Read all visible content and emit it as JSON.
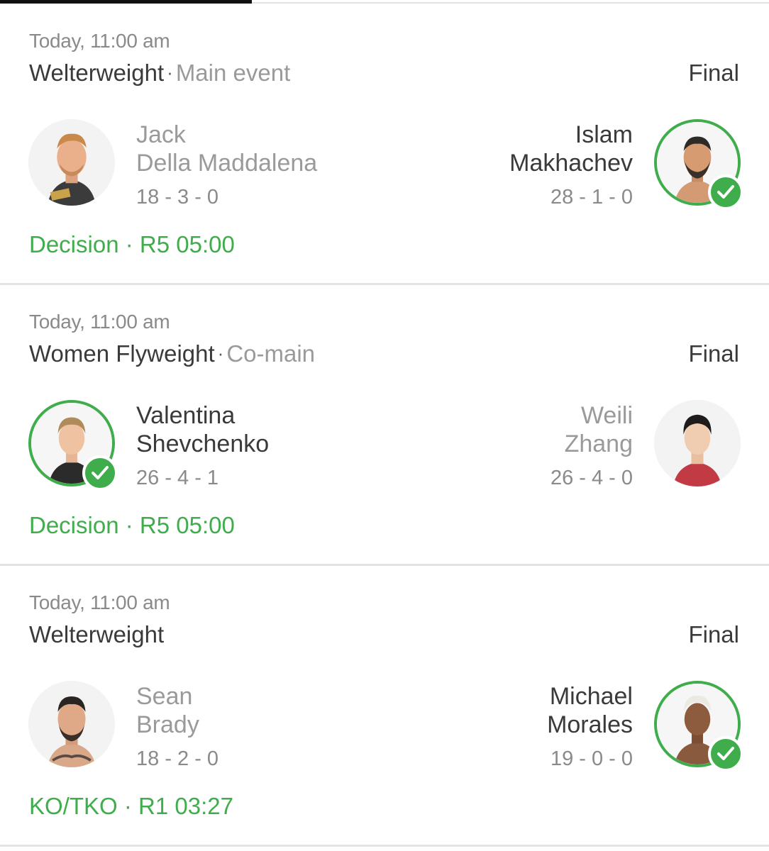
{
  "fights": [
    {
      "time": "Today, 11:00 am",
      "weight_class": "Welterweight",
      "billing": "Main event",
      "status": "Final",
      "left": {
        "first": "Jack",
        "last": "Della Maddalena",
        "record": "18 - 3 - 0",
        "winner": false,
        "photo": "fighter-photo"
      },
      "right": {
        "first": "Islam",
        "last": "Makhachev",
        "record": "28 - 1 - 0",
        "winner": true,
        "photo": "fighter-photo"
      },
      "result": "Decision · R5 05:00"
    },
    {
      "time": "Today, 11:00 am",
      "weight_class": "Women Flyweight",
      "billing": "Co-main",
      "status": "Final",
      "left": {
        "first": "Valentina",
        "last": "Shevchenko",
        "record": "26 - 4 - 1",
        "winner": true,
        "photo": "fighter-photo"
      },
      "right": {
        "first": "Weili",
        "last": "Zhang",
        "record": "26 - 4 - 0",
        "winner": false,
        "photo": "fighter-photo"
      },
      "result": "Decision · R5 05:00"
    },
    {
      "time": "Today, 11:00 am",
      "weight_class": "Welterweight",
      "billing": "",
      "status": "Final",
      "left": {
        "first": "Sean",
        "last": "Brady",
        "record": "18 - 2 - 0",
        "winner": false,
        "photo": "fighter-photo"
      },
      "right": {
        "first": "Michael",
        "last": "Morales",
        "record": "19 - 0 - 0",
        "winner": true,
        "photo": "fighter-photo"
      },
      "result": "KO/TKO · R1 03:27"
    }
  ],
  "colors": {
    "win_green": "#3fad4b",
    "text_dark": "#3a3a3a",
    "text_muted": "#9a9a9a"
  },
  "icons": {
    "winner_badge": "check-icon"
  }
}
